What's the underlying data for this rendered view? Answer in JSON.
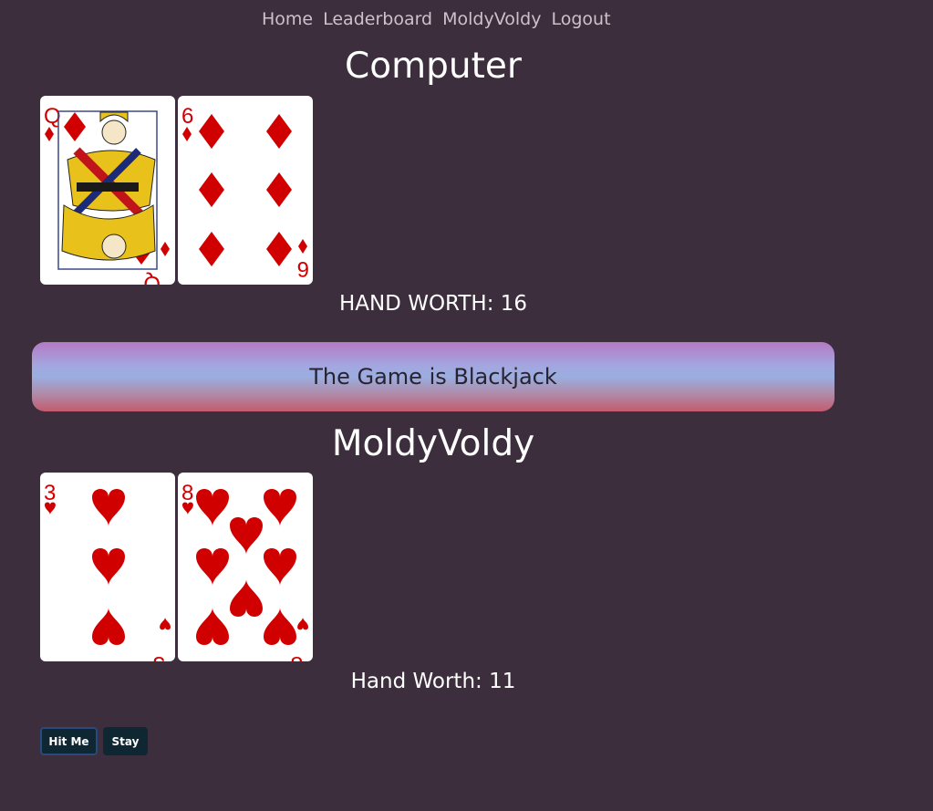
{
  "nav": {
    "home": "Home",
    "leaderboard": "Leaderboard",
    "user": "MoldyVoldy",
    "logout": "Logout"
  },
  "computer": {
    "title": "Computer",
    "cards": [
      {
        "rank": "Q",
        "suit": "diamonds"
      },
      {
        "rank": "6",
        "suit": "diamonds"
      }
    ],
    "hand_worth": "HAND WORTH: 16"
  },
  "banner": {
    "text": "The Game is Blackjack"
  },
  "player": {
    "title": "MoldyVoldy",
    "cards": [
      {
        "rank": "3",
        "suit": "hearts"
      },
      {
        "rank": "8",
        "suit": "hearts"
      }
    ],
    "hand_worth": "Hand Worth: 11"
  },
  "actions": {
    "hit": "Hit Me",
    "stay": "Stay"
  },
  "colors": {
    "background": "#3c2e3c",
    "suit_red": "#d10000",
    "button": "#0f2733"
  }
}
